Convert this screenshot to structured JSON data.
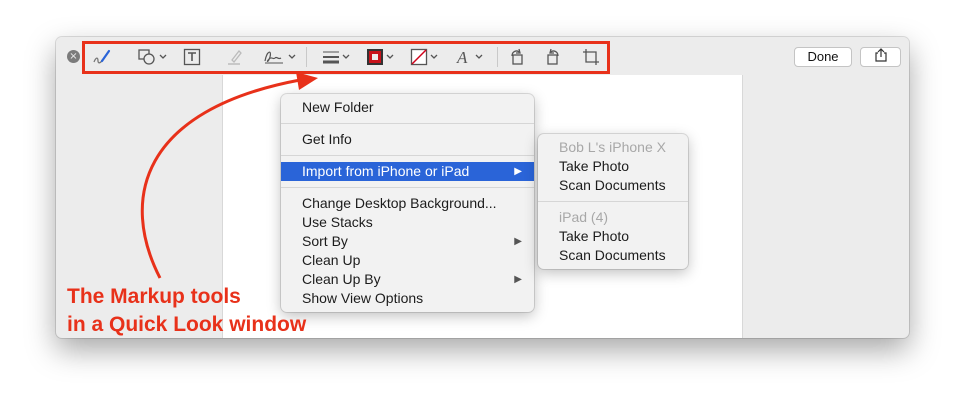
{
  "toolbar": {
    "tools": [
      {
        "name": "sketch-tool",
        "icon": "sketch-icon"
      },
      {
        "name": "shapes-tool",
        "icon": "shapes-icon"
      },
      {
        "name": "text-tool",
        "icon": "text-box-icon"
      },
      {
        "name": "highlight-tool",
        "icon": "highlighter-icon"
      },
      {
        "name": "sign-tool",
        "icon": "signature-icon"
      },
      {
        "name": "shape-style-tool",
        "icon": "line-style-icon"
      },
      {
        "name": "border-color-tool",
        "icon": "border-color-icon"
      },
      {
        "name": "fill-color-tool",
        "icon": "fill-color-icon"
      },
      {
        "name": "text-style-tool",
        "icon": "text-style-icon"
      },
      {
        "name": "rotate-left-tool",
        "icon": "rotate-left-icon"
      },
      {
        "name": "rotate-right-tool",
        "icon": "rotate-right-icon"
      },
      {
        "name": "crop-tool",
        "icon": "crop-icon"
      }
    ],
    "done_label": "Done",
    "share_icon": "share-icon",
    "close_glyph": "×"
  },
  "context_menu": {
    "items": [
      {
        "label": "New Folder"
      },
      {
        "label": "Get Info"
      },
      {
        "label": "Import from iPhone or iPad",
        "submenu": true
      },
      {
        "label": "Change Desktop Background..."
      },
      {
        "label": "Use Stacks"
      },
      {
        "label": "Sort By",
        "submenu": true
      },
      {
        "label": "Clean Up"
      },
      {
        "label": "Clean Up By",
        "submenu": true
      },
      {
        "label": "Show View Options"
      }
    ],
    "submenu_arrow": "▶",
    "highlight_color": "#2a64d8"
  },
  "sub_menu": {
    "items": [
      {
        "label": "Bob L's iPhone X",
        "disabled": true
      },
      {
        "label": "Take Photo"
      },
      {
        "label": "Scan Documents"
      },
      {
        "label": "iPad (4)",
        "disabled": true
      },
      {
        "label": "Take Photo"
      },
      {
        "label": "Scan Documents"
      }
    ]
  },
  "annotation": {
    "line1": "The Markup tools",
    "line2": "in a Quick Look window",
    "color": "#e8311a"
  }
}
